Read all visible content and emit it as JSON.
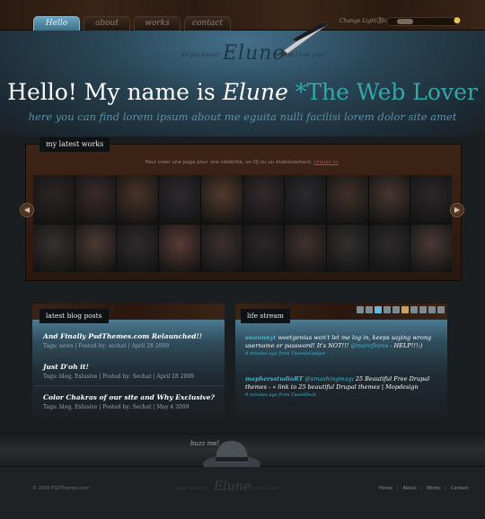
{
  "nav": {
    "tabs": [
      "Hello",
      "about",
      "works",
      "contact"
    ],
    "active_index": 0
  },
  "light_mood": {
    "label": "Change Light Mood",
    "level": 0.15
  },
  "header": {
    "logo": "Elune",
    "left_tagline": "do you know?",
    "right_tagline": "what I love you?",
    "greeting": "Hello! My name is",
    "name": "Elune",
    "tag": "*The Web Lover",
    "subtitle": "here you can find lorem ipsum about me eguita nulli facilisi lorem dolor site amet"
  },
  "works": {
    "label": "my latest works",
    "caption": "Pour créer une page pour une célébrité, un DJ ou un établissement, cliquez ici.",
    "caption_link": "cliquez ici",
    "photo_count": 20
  },
  "blog": {
    "label": "latest blog posts",
    "posts": [
      {
        "title": "And Finally PsdThemes.com Relaunched!!",
        "meta": "Tags: news | Posted by: sechat | April 28 2009"
      },
      {
        "title": "Just D'oh it!",
        "meta": "Tags: blog, Exlusive | Posted by: Sechat | April 28 2009"
      },
      {
        "title": "Color Chakras of our site and Why Exclusive?",
        "meta": "Tags: blog, Exlusive | Posted by: Sechat | May 4 2009"
      }
    ]
  },
  "stream": {
    "label": "life stream",
    "tweets": [
      {
        "user": "swannnyt",
        "text": " weetgenius won't let me log in, keeps saying wrong username or password! It's NOT!!! ",
        "mention": "@marcflores",
        "tail": " - HELP!!!:)",
        "time": "4 minutes ago from TweetieGadget"
      },
      {
        "user": "maphersstudioRT",
        "text": " ",
        "mention": "@smashingmag",
        "tail": ": 25 Beautiful Free Drupal themes - » link to 25 beautiful Drupal themes | Mopdesign",
        "time": "9 minutes ago from TweetDeck"
      }
    ]
  },
  "footer": {
    "buzz": "buzz me!",
    "copyright": "© 2009 PSDThemes.com",
    "logo": "Elune",
    "left": "elune glow on",
    "right": "the web lover",
    "links": [
      "Home",
      "About",
      "Works",
      "Contact"
    ]
  }
}
